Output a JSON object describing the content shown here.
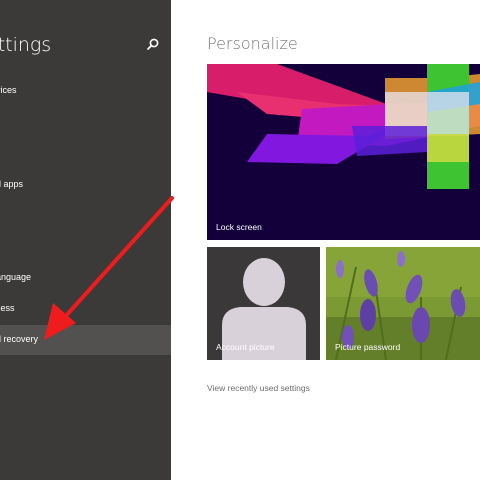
{
  "sidebar": {
    "title": "ettings",
    "items": [
      {
        "label": "vices"
      },
      {
        "label": "d apps"
      },
      {
        "label": "anguage"
      },
      {
        "label": "cess"
      },
      {
        "label": "d recovery"
      }
    ]
  },
  "main": {
    "title": "Personalize",
    "tiles": {
      "lock_screen": "Lock screen",
      "account_picture": "Account picture",
      "picture_password": "Picture password"
    },
    "recent_link": "View recently used settings"
  },
  "icons": {
    "search": "search-icon",
    "arrow": "red-arrow-annotation",
    "avatar": "user-silhouette-icon"
  },
  "colors": {
    "sidebar_bg": "#3c3a39",
    "selected_bg": "#53514f",
    "arrow": "#ee1c1c",
    "lockscreen_bg": "#13003b"
  }
}
